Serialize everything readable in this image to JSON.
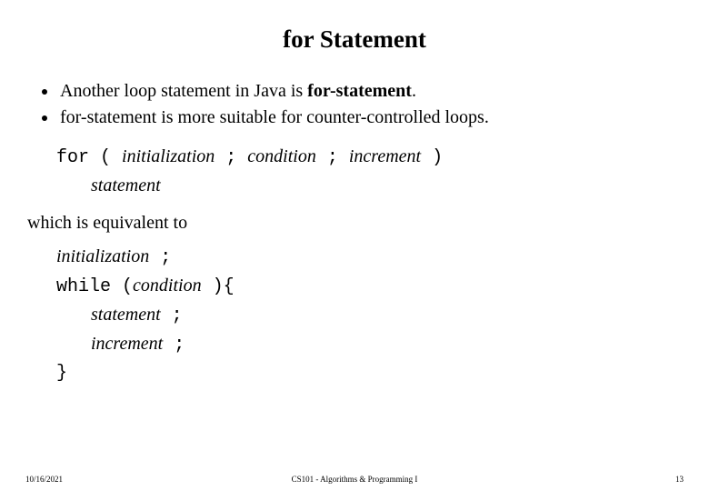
{
  "title": "for Statement",
  "bullets": {
    "b1a": "Another loop statement in Java is ",
    "b1b": "for-statement",
    "b1c": ".",
    "b2": "for-statement is more suitable for counter-controlled loops."
  },
  "syntax": {
    "for_kw": "for",
    "lparen": " ( ",
    "init": "initialization",
    "semi1": " ; ",
    "cond": "condition",
    "semi2": " ; ",
    "incr": "increment",
    "rparen": " )",
    "stmt": "statement"
  },
  "equiv_text": "which is equivalent to",
  "code": {
    "l1a": "initialization",
    "l1b": " ;",
    "l2a": "while",
    "l2b": " (",
    "l2c": "condition",
    "l2d": " ){",
    "l3a": "statement",
    "l3b": " ;",
    "l4a": "increment",
    "l4b": " ;",
    "l5": "}"
  },
  "footer": {
    "date": "10/16/2021",
    "course": "CS101 - Algorithms & Programming I",
    "page": "13"
  }
}
